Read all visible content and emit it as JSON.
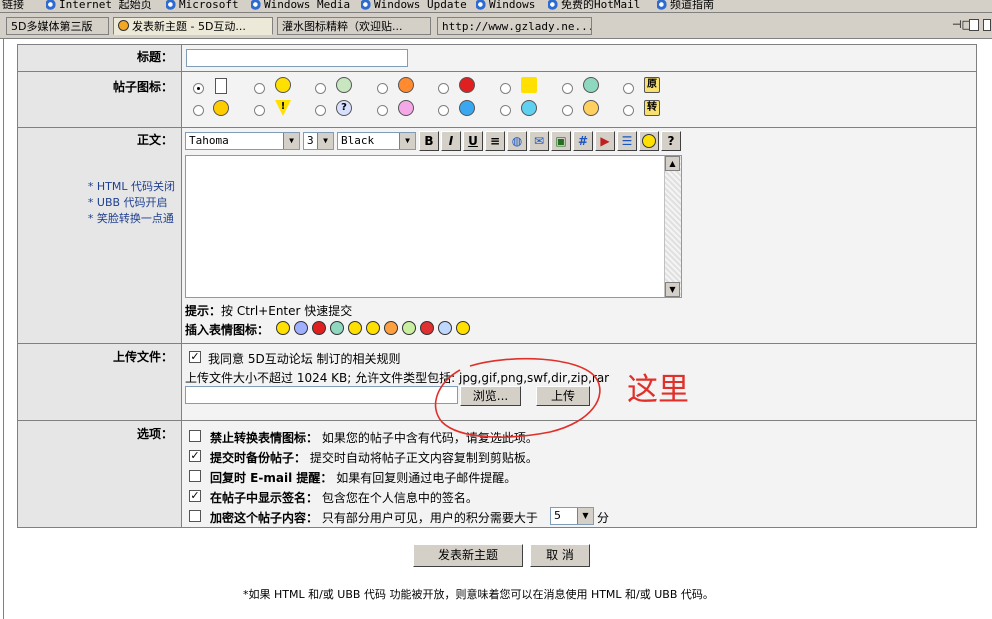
{
  "links_bar": {
    "label": "链接",
    "items": [
      "Internet 起始页",
      "Microsoft",
      "Windows Media",
      "Windows Update",
      "Windows",
      "免费的HotMail",
      "频道指南"
    ]
  },
  "tabs": [
    {
      "label": "5D多媒体第三版"
    },
    {
      "label": "发表新主题 - 5D互动..."
    },
    {
      "label": "灌水图标精粹（欢迎贴..."
    },
    {
      "label": "http://www.gzlady.ne..."
    }
  ],
  "form": {
    "title_label": "标题：",
    "title_value": "",
    "icon_label": "帖子图标：",
    "icon_text_1": "原",
    "icon_text_2": "转",
    "body_label": "正文：",
    "body_notes": [
      "* HTML 代码关闭",
      "* UBB  代码开启",
      "* 笑脸转换一点通"
    ],
    "editor": {
      "font": "Tahoma",
      "size": "3",
      "color": "Black",
      "content": ""
    },
    "hint_label": "提示：",
    "hint_text": "按 Ctrl+Enter 快速提交",
    "emote_label": "插入表情图标：",
    "upload_label": "上传文件：",
    "agree_text": "我同意 5D互动论坛 制订的相关规则",
    "upload_info": "上传文件大小不超过  1024 KB; 允许文件类型包括: jpg,gif,png,swf,dir,zip,rar",
    "browse_label": "浏览...",
    "upload_button": "上传",
    "annotation": "这里",
    "options_label": "选项：",
    "options": [
      {
        "checked": false,
        "title": "禁止转换表情图标：",
        "desc": "如果您的帖子中含有代码，请复选此项。"
      },
      {
        "checked": true,
        "title": "提交时备份帖子：",
        "desc": "提交时自动将帖子正文内容复制到剪贴板。"
      },
      {
        "checked": false,
        "title": "回复时 E-mail 提醒：",
        "desc": "如果有回复则通过电子邮件提醒。"
      },
      {
        "checked": true,
        "title": "在帖子中显示签名：",
        "desc": "包含您在个人信息中的签名。"
      },
      {
        "checked": false,
        "title": "加密这个帖子内容：",
        "desc": "只有部分用户可见，用户的积分需要大于"
      }
    ],
    "points_value": "5",
    "points_unit": "分",
    "submit_label": "发表新主题",
    "cancel_label": "取 消",
    "footer_note": "*如果 HTML 和/或 UBB 代码 功能被开放，则意味着您可以在消息使用 HTML 和/或 UBB 代码。"
  },
  "colors": {
    "accent_red": "#e0302a",
    "toolbar_bg": "#d4d0c8"
  }
}
